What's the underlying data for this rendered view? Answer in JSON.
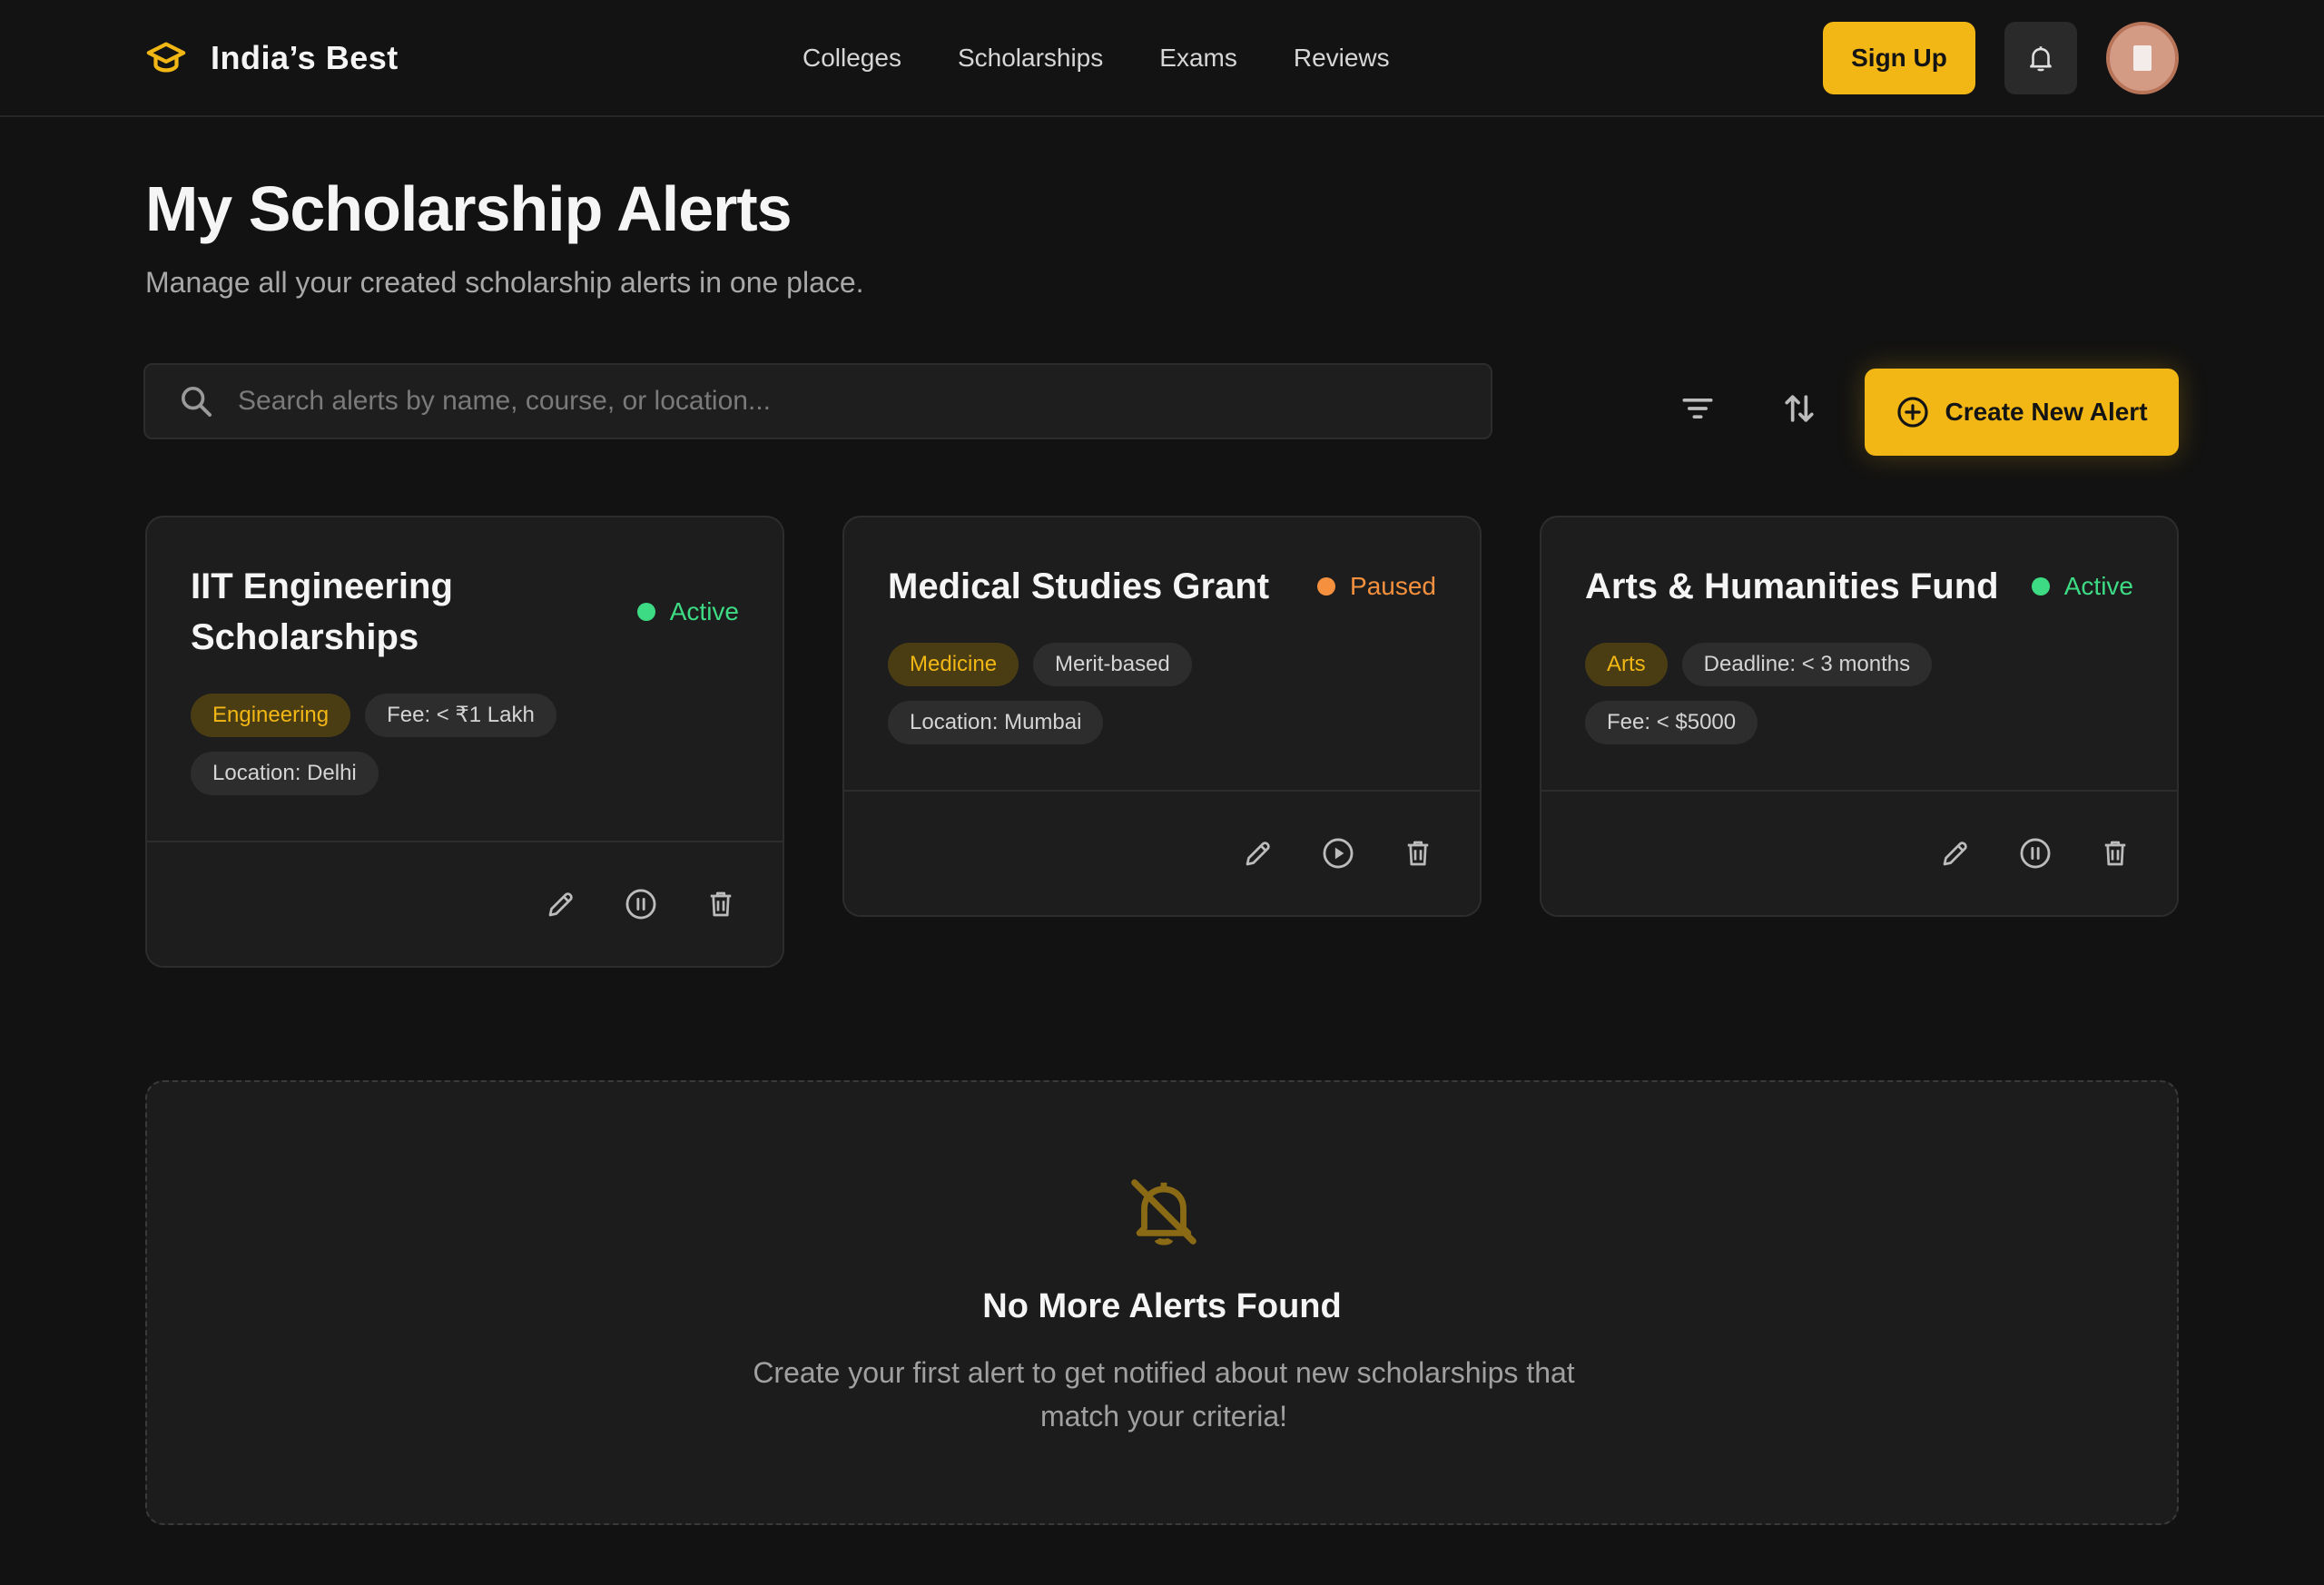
{
  "header": {
    "brand": "India’s Best",
    "nav": [
      "Colleges",
      "Scholarships",
      "Exams",
      "Reviews"
    ],
    "signup_label": "Sign Up"
  },
  "page": {
    "title": "My Scholarship Alerts",
    "subtitle": "Manage all your created scholarship alerts in one place."
  },
  "toolbar": {
    "search_placeholder": "Search alerts by name, course, or location...",
    "search_value": "",
    "create_label": "Create New Alert"
  },
  "alerts": [
    {
      "title": "IIT Engineering Scholarships",
      "status": "Active",
      "tags": [
        "Engineering",
        "Fee: < ₹1 Lakh",
        "Location: Delhi"
      ],
      "toggle_action": "pause"
    },
    {
      "title": "Medical Studies Grant",
      "status": "Paused",
      "tags": [
        "Medicine",
        "Merit-based",
        "Location: Mumbai"
      ],
      "toggle_action": "play"
    },
    {
      "title": "Arts & Humanities Fund",
      "status": "Active",
      "tags": [
        "Arts",
        "Deadline: < 3 months",
        "Fee: < $5000"
      ],
      "toggle_action": "pause"
    }
  ],
  "empty_state": {
    "title": "No More Alerts Found",
    "text": "Create your first alert to get notified about new scholarships that match your criteria!"
  },
  "colors": {
    "accent": "#f2b714",
    "active": "#3ddc84",
    "paused": "#f5913e",
    "background": "#121212",
    "card": "#1d1d1d"
  }
}
